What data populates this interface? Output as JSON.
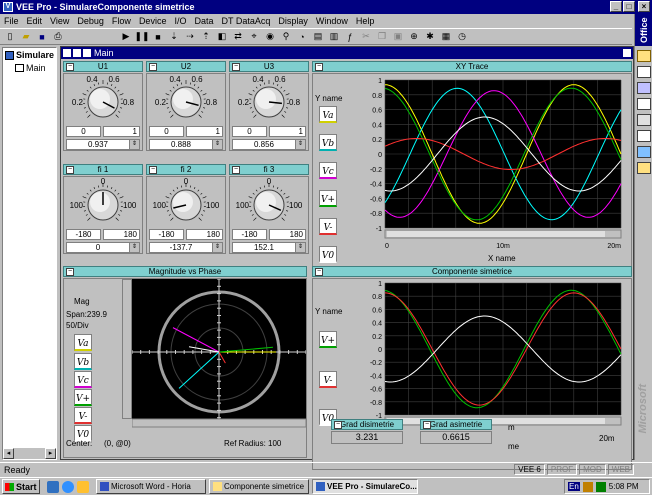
{
  "app": {
    "title": "VEE Pro - SimulareComponente simetrice"
  },
  "menu": [
    "File",
    "Edit",
    "View",
    "Debug",
    "Flow",
    "Device",
    "I/O",
    "Data",
    "DT DataAcq",
    "Display",
    "Window",
    "Help"
  ],
  "sidebar": {
    "root": "Simulare",
    "child": "Main"
  },
  "office_label": "Office",
  "main_window": {
    "title": "Main"
  },
  "u_panels": [
    {
      "title": "U1",
      "min": "0",
      "max": "1",
      "value": "0.937",
      "knob_value": 0.937
    },
    {
      "title": "U2",
      "min": "0",
      "max": "1",
      "value": "0.888",
      "knob_value": 0.888
    },
    {
      "title": "U3",
      "min": "0",
      "max": "1",
      "value": "0.856",
      "knob_value": 0.856
    }
  ],
  "fi_panels": [
    {
      "title": "fi 1",
      "min": "-180",
      "max": "180",
      "value": "0",
      "knob_value": 0
    },
    {
      "title": "fi 2",
      "min": "-180",
      "max": "180",
      "value": "-137.7",
      "knob_value": -137.7
    },
    {
      "title": "fi 3",
      "min": "-180",
      "max": "180",
      "value": "152.1",
      "knob_value": 152.1
    }
  ],
  "u_knob_ticks": {
    "t0": "0",
    "t2": "0.2",
    "t4": "0.4",
    "t6": "0.6",
    "t8": "0.8",
    "t10": "1"
  },
  "fi_knob_ticks": {
    "top": "0",
    "left": "100",
    "right": "100"
  },
  "xy_trace": {
    "title": "XY Trace",
    "y_name": "Y name",
    "x_name": "X name",
    "legend": [
      "Va",
      "Vb",
      "Vc",
      "V+",
      "V-",
      "V0"
    ],
    "y_ticks": [
      "1",
      "0.8",
      "0.6",
      "0.4",
      "0.2",
      "0",
      "-0.2",
      "-0.4",
      "-0.6",
      "-0.8",
      "-1"
    ],
    "x_ticks": [
      "0",
      "10m",
      "20m"
    ]
  },
  "mag_phase": {
    "title": "Magnitude vs Phase",
    "mag_label": "Mag",
    "span": "Span:239.9",
    "per_div": "50/Div",
    "legend": [
      "Va",
      "Vb",
      "Vc",
      "V+",
      "V-",
      "V0"
    ],
    "center_label": "Center:",
    "center_value": "(0, @0)",
    "ref_radius": "Ref Radius: 100"
  },
  "components": {
    "title": "Componente simetrice",
    "y_name": "Y name",
    "legend": [
      "V+",
      "V-",
      "V0"
    ],
    "y_ticks": [
      "1",
      "0.8",
      "0.6",
      "0.4",
      "0.2",
      "0",
      "-0.2",
      "-0.4",
      "-0.6",
      "-0.8",
      "-1"
    ],
    "x_tick_right": "20m",
    "x_label_m": "m",
    "x_label_me": "me"
  },
  "grad_disimetrie": {
    "title": "Grad disimetrie",
    "value": "3.231"
  },
  "grad_asimetrie": {
    "title": "Grad asimetrie",
    "value": "0.6615"
  },
  "status": {
    "text": "Ready",
    "indicators": [
      "VEE 6",
      "PROF",
      "MOD",
      "WEB"
    ]
  },
  "taskbar": {
    "start": "Start",
    "tasks": [
      "Microsoft Word - Horia",
      "Componente simetrice",
      "VEE Pro - SimulareCo..."
    ],
    "lang": "En",
    "clock": "5:08 PM"
  },
  "watermark": "Microsoft",
  "chart_data": [
    {
      "type": "line",
      "title": "XY Trace",
      "xlabel": "X name",
      "ylabel": "Y name",
      "xlim": [
        0,
        0.02
      ],
      "ylim": [
        -1,
        1
      ],
      "series": [
        {
          "name": "Va",
          "amplitude": 0.937,
          "phase_deg": 0,
          "color": "#ffff00"
        },
        {
          "name": "Vb",
          "amplitude": 0.888,
          "phase_deg": -137.7,
          "color": "#00ffff"
        },
        {
          "name": "Vc",
          "amplitude": 0.856,
          "phase_deg": 152.1,
          "color": "#ff00ff"
        },
        {
          "name": "V+",
          "amplitude": 0.89,
          "phase_deg": 5,
          "color": "#00c000"
        },
        {
          "name": "V-",
          "amplitude": 0.21,
          "phase_deg": -60,
          "color": "#ff3030"
        },
        {
          "name": "V0",
          "amplitude": 0.5,
          "phase_deg": 170,
          "color": "#ffffff"
        }
      ]
    },
    {
      "type": "line",
      "title": "Componente simetrice",
      "xlabel": "",
      "ylabel": "Y name",
      "xlim": [
        0,
        0.02
      ],
      "ylim": [
        -1,
        1
      ],
      "series": [
        {
          "name": "V+",
          "amplitude": 0.89,
          "phase_deg": 5,
          "color": "#00c000"
        },
        {
          "name": "V-",
          "amplitude": 0.85,
          "phase_deg": 0,
          "color": "#ff3030"
        },
        {
          "name": "V0",
          "amplitude": 0.5,
          "phase_deg": 170,
          "color": "#ffffff"
        }
      ]
    }
  ]
}
